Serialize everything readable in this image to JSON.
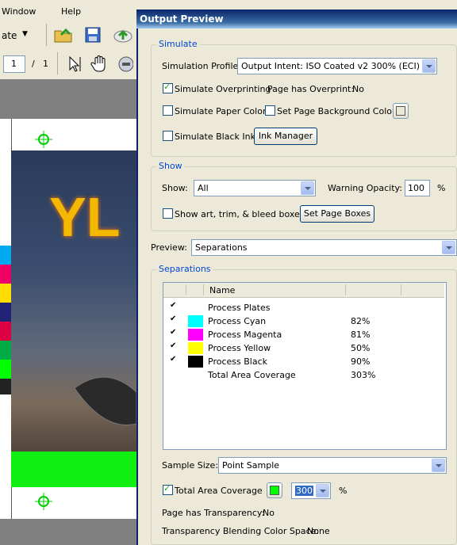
{
  "menu": {
    "window": "Window",
    "help": "Help"
  },
  "toolbar": {
    "dropdown_text": "ate",
    "page_current": "1",
    "page_sep": "/",
    "page_total": "1"
  },
  "artwork": {
    "text": "YL"
  },
  "panel": {
    "title": "Output Preview",
    "simulate": {
      "legend": "Simulate",
      "profile_label": "Simulation Profile:",
      "profile_value": "Output Intent: ISO Coated v2 300% (ECI)",
      "overprint_label": "Simulate Overprinting",
      "page_overprint_label": "Page has Overprint:",
      "page_overprint_value": "No",
      "paper_color_label": "Simulate Paper Color",
      "page_bg_label": "Set Page Background Color",
      "black_ink_label": "Simulate Black Ink",
      "ink_manager_label": "Ink Manager",
      "overprint_checked": true,
      "paper_checked": false,
      "bg_checked": false,
      "black_checked": false
    },
    "show": {
      "legend": "Show",
      "show_label": "Show:",
      "show_value": "All",
      "warning_label": "Warning Opacity:",
      "warning_value": "100",
      "percent": "%",
      "boxes_label": "Show art, trim, & bleed boxes",
      "set_boxes_label": "Set Page Boxes"
    },
    "preview": {
      "label": "Preview:",
      "value": "Separations"
    },
    "separations": {
      "legend": "Separations",
      "name_header": "Name",
      "rows": [
        {
          "name": "Process Plates",
          "value": "",
          "color": "",
          "checked": true
        },
        {
          "name": "Process Cyan",
          "value": "82%",
          "color": "#00ffff",
          "checked": true
        },
        {
          "name": "Process Magenta",
          "value": "81%",
          "color": "#ff00ff",
          "checked": true
        },
        {
          "name": "Process Yellow",
          "value": "50%",
          "color": "#ffff00",
          "checked": true
        },
        {
          "name": "Process Black",
          "value": "90%",
          "color": "#000000",
          "checked": true
        },
        {
          "name": "Total Area Coverage",
          "value": "303%",
          "color": "",
          "checked": false
        }
      ],
      "sample_size_label": "Sample Size:",
      "sample_size_value": "Point Sample",
      "tac_label": "Total Area Coverage",
      "tac_value": "300",
      "tac_percent": "%",
      "tac_color": "#00ff00",
      "transparency_label": "Page has Transparency:",
      "transparency_value": "No",
      "blend_label": "Transparency Blending Color Space:",
      "blend_value": "None"
    }
  }
}
